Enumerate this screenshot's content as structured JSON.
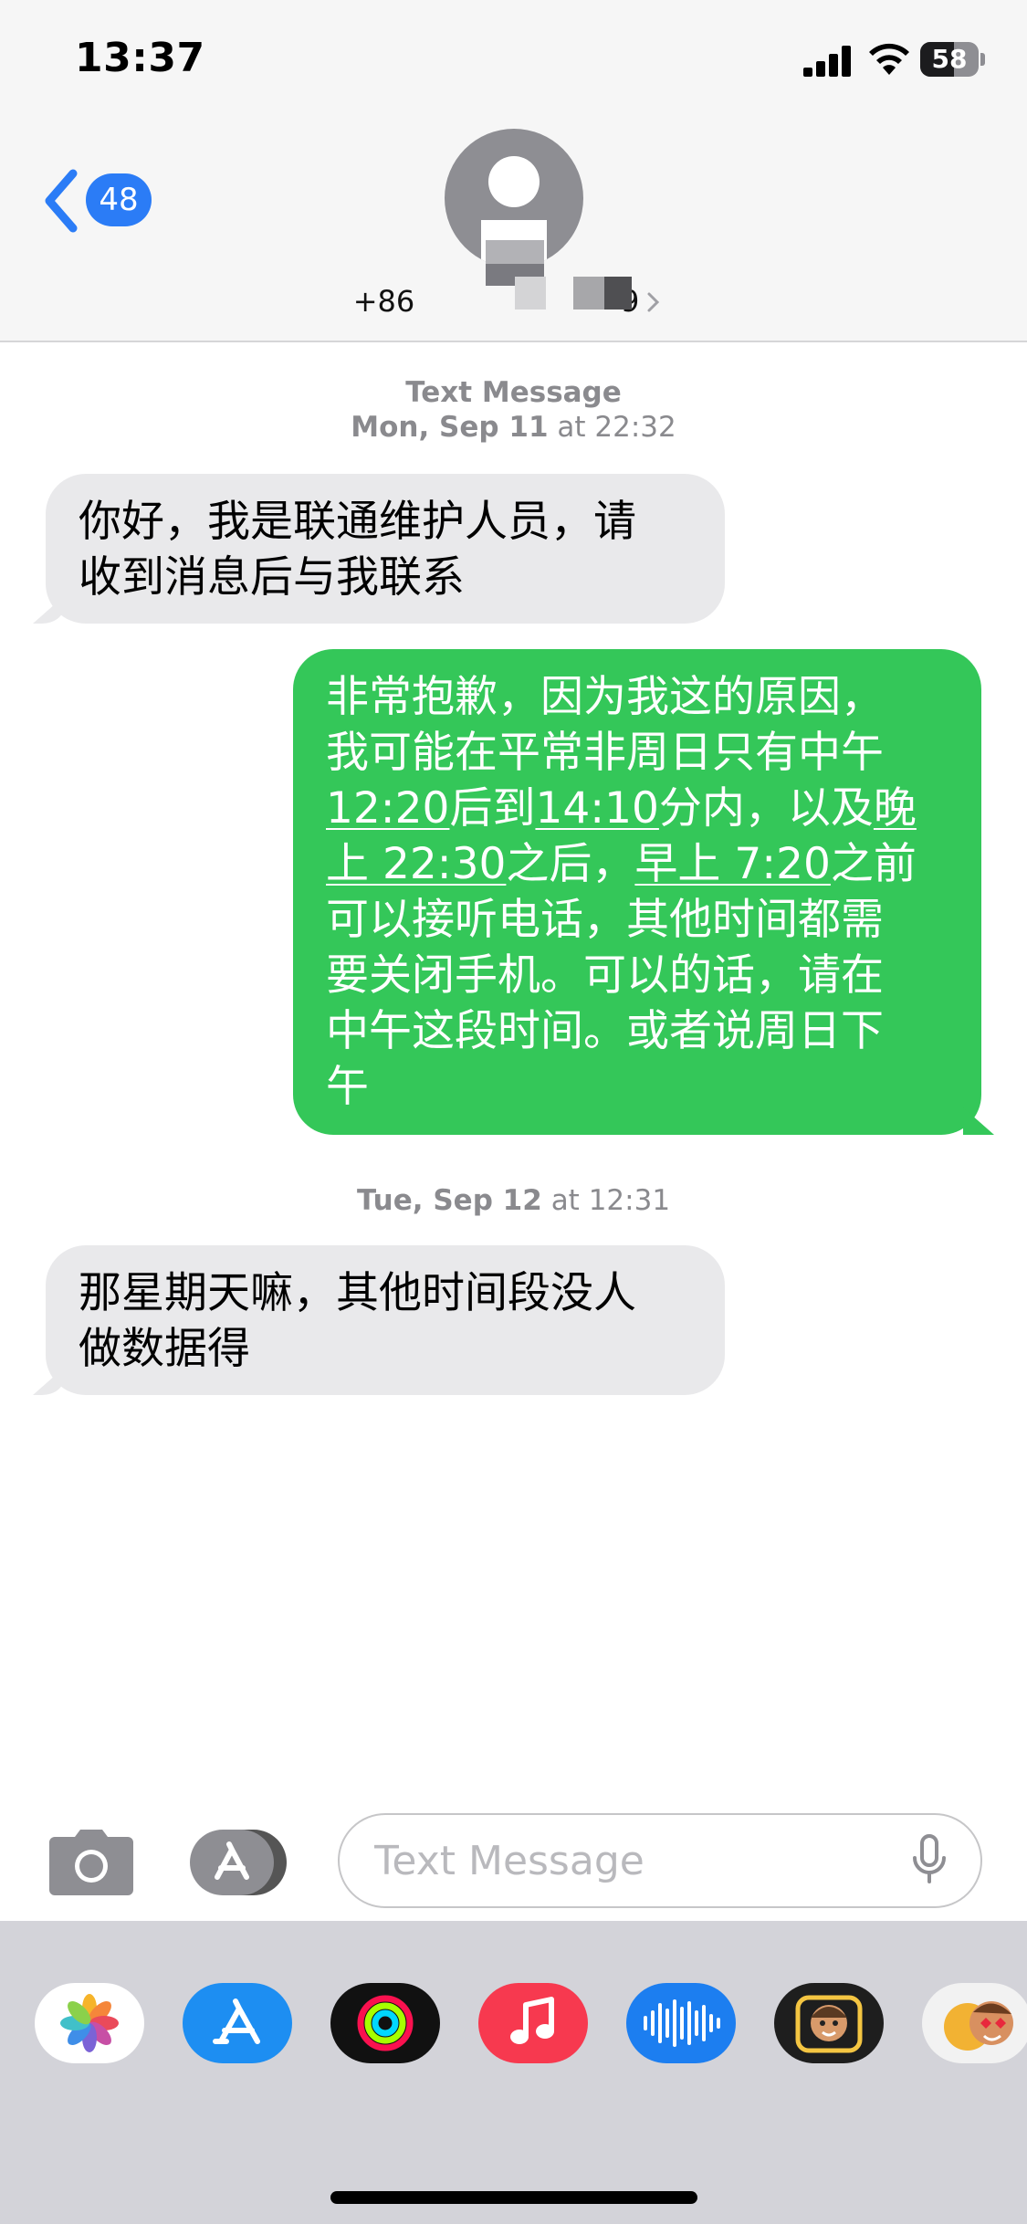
{
  "status_bar": {
    "time": "13:37",
    "battery_level": "58",
    "battery_fraction": 0.58
  },
  "header": {
    "back_badge_count": "48",
    "contact_number_prefix": "+86",
    "contact_number_suffix": "9"
  },
  "conversation": {
    "groups": [
      {
        "service": "Text Message",
        "day": "Mon, Sep 11",
        "at": "at",
        "time": "22:32"
      },
      {
        "day": "Tue, Sep 12",
        "at": "at",
        "time": "12:31"
      }
    ],
    "messages": [
      {
        "direction": "incoming",
        "text_line1": "你好，我是联通维护人员，请",
        "text_line2": "收到消息后与我联系"
      },
      {
        "direction": "outgoing",
        "l1": "非常抱歉，因为我这的原因，",
        "l2": "我可能在平常非周日只有中午",
        "l3_a": "12:20",
        "l3_b": "后到",
        "l3_c": "14:10",
        "l3_d": "分内，以及",
        "l3_e": "晚",
        "l4_a": "上 22:30",
        "l4_b": "之后，",
        "l4_c": "早上 7:20",
        "l4_d": "之前",
        "l5": "可以接听电话，其他时间都需",
        "l6": "要关闭手机。可以的话，请在",
        "l7": "中午这段时间。或者说周日下",
        "l8": "午"
      },
      {
        "direction": "incoming",
        "text_line1": "那星期天嘛，其他时间段没人",
        "text_line2": "做数据得"
      }
    ]
  },
  "compose": {
    "placeholder": "Text Message"
  },
  "app_strip": {
    "apps": [
      "photos-icon",
      "app-store-icon",
      "fitness-icon",
      "music-icon",
      "voice-memos-icon",
      "memoji-icon",
      "animoji-stickers-icon"
    ]
  },
  "colors": {
    "accent_blue": "#2b7cf6",
    "outgoing_green": "#34c759",
    "incoming_gray": "#e9e9eb"
  }
}
